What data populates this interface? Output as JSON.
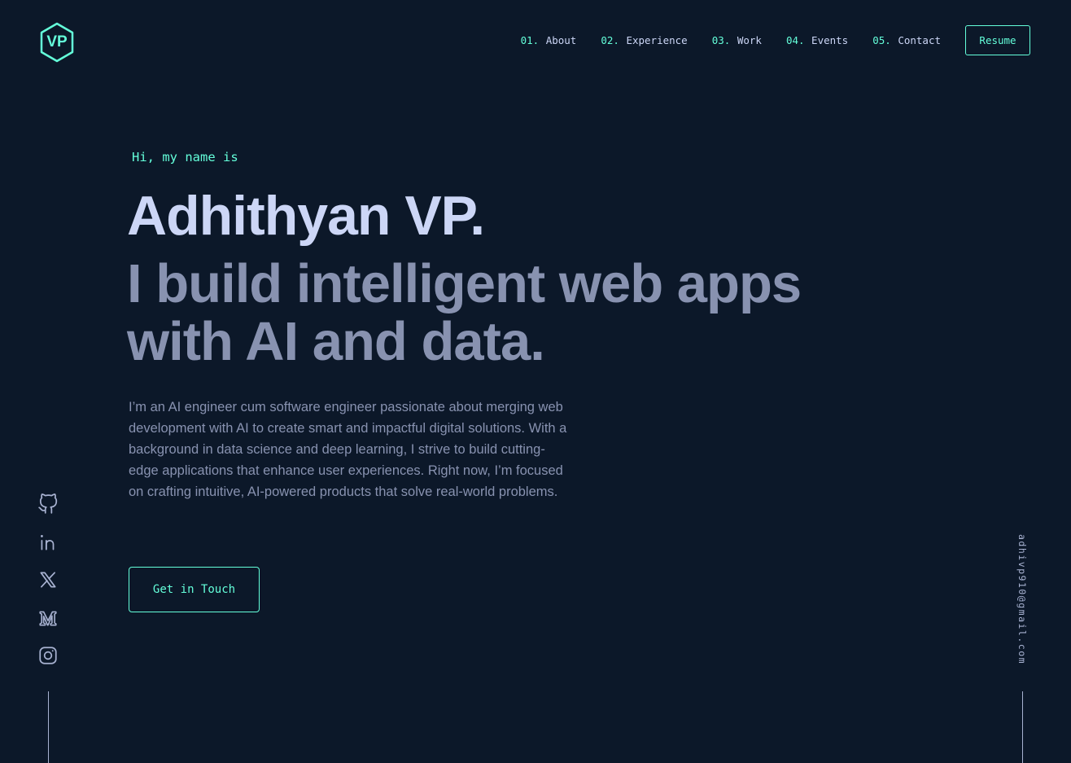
{
  "header": {
    "logo_text": "VP",
    "nav": [
      {
        "num": "01.",
        "label": "About"
      },
      {
        "num": "02.",
        "label": "Experience"
      },
      {
        "num": "03.",
        "label": "Work"
      },
      {
        "num": "04.",
        "label": "Events"
      },
      {
        "num": "05.",
        "label": "Contact"
      }
    ],
    "resume_label": "Resume"
  },
  "hero": {
    "greeting": "Hi, my name is",
    "name": "Adhithyan VP.",
    "tagline": "I build intelligent web apps with AI and data.",
    "bio": "I’m an AI engineer cum software engineer passionate about merging web development with AI to create smart and impactful digital solutions. With a background in data science and deep learning, I strive to build cutting-edge applications that enhance user experiences. Right now, I’m focused on crafting intuitive, AI-powered products that solve real-world problems.",
    "cta_label": "Get in Touch"
  },
  "social": {
    "icons": [
      "github-icon",
      "linkedin-icon",
      "x-twitter-icon",
      "medium-icon",
      "instagram-icon"
    ]
  },
  "email": "adhivp910@gmail.com",
  "colors": {
    "background": "#0c1829",
    "accent": "#64ffda",
    "heading": "#ccd6f6",
    "body_text": "#8892b0"
  }
}
